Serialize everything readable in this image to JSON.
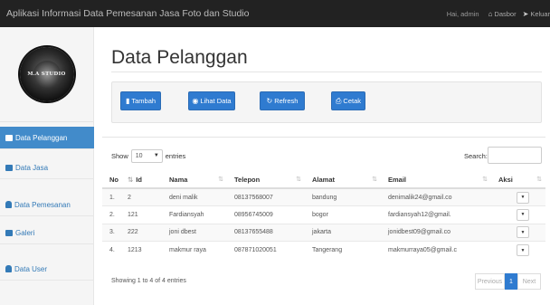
{
  "navbar": {
    "brand": "Aplikasi Informasi Data Pemesanan Jasa Foto dan Studio",
    "greeting": "Hai, admin",
    "dashboard_label": "Dasbor",
    "logout_label": "Keluar"
  },
  "logo": {
    "text": "M.A STUDIO"
  },
  "sidebar": {
    "items": [
      {
        "label": "Data Pelanggan",
        "icon": "book-icon",
        "active": true
      },
      {
        "label": "Data Jasa",
        "icon": "picture-icon",
        "active": false
      },
      {
        "label": "Data Pemesanan",
        "icon": "user-icon",
        "active": false
      },
      {
        "label": "Galeri",
        "icon": "image-icon",
        "active": false
      },
      {
        "label": "Data User",
        "icon": "user-icon",
        "active": false
      }
    ]
  },
  "page": {
    "title": "Data Pelanggan"
  },
  "toolbar": {
    "tambah": "Tambah",
    "lihat": "Lihat Data",
    "refresh": "Refresh",
    "cetak": "Cetak"
  },
  "table_controls": {
    "show": "Show",
    "entries_value": "10",
    "entries": "entries",
    "search": "Search:"
  },
  "table": {
    "headers": [
      "No",
      "Id",
      "Nama",
      "Telepon",
      "Alamat",
      "Email",
      "Aksi"
    ],
    "rows": [
      [
        "1.",
        "2",
        "deni malik",
        "08137568007",
        "bandung",
        "denimalik24@gmail.co"
      ],
      [
        "2.",
        "121",
        "Fardiansyah",
        "08956745009",
        "bogor",
        "fardiansyah12@gmail."
      ],
      [
        "3.",
        "222",
        "joni dbest",
        "08137655488",
        "jakarta",
        "jonidbest09@gmail.co"
      ],
      [
        "4.",
        "1213",
        "makmur raya",
        "087871020051",
        "Tangerang",
        "makmurraya05@gmail.c"
      ]
    ]
  },
  "footer": {
    "info": "Showing 1 to 4 of 4 entries",
    "previous": "Previous",
    "page": "1",
    "next": "Next"
  },
  "colors": {
    "navbar": "#222222",
    "accent": "#428bca",
    "button": "#2f7bd0"
  }
}
